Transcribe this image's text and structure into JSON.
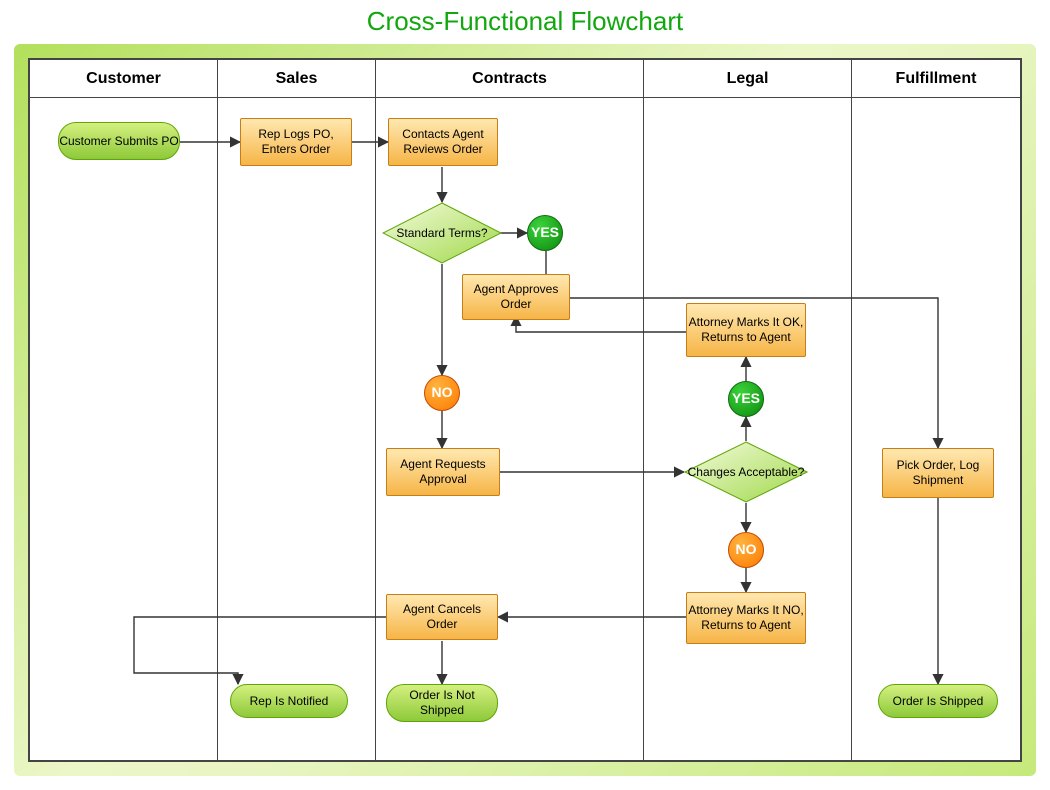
{
  "title": "Cross-Functional Flowchart",
  "lanes": [
    "Customer",
    "Sales",
    "Contracts",
    "Legal",
    "Fulfillment"
  ],
  "nodes": {
    "customer_submits": "Customer Submits PO",
    "rep_logs": "Rep Logs PO, Enters Order",
    "reviews": "Contacts Agent Reviews Order",
    "standard_terms": "Standard Terms?",
    "yes1": "YES",
    "approves": "Agent Approves Order",
    "attorney_ok": "Attorney Marks It OK, Returns to Agent",
    "yes2": "YES",
    "no1": "NO",
    "requests": "Agent Requests Approval",
    "changes": "Changes Acceptable?",
    "pick": "Pick Order, Log Shipment",
    "no2": "NO",
    "attorney_no": "Attorney Marks It NO, Returns to Agent",
    "cancels": "Agent Cancels Order",
    "rep_notified": "Rep Is Notified",
    "not_shipped": "Order Is Not Shipped",
    "shipped": "Order Is Shipped"
  }
}
